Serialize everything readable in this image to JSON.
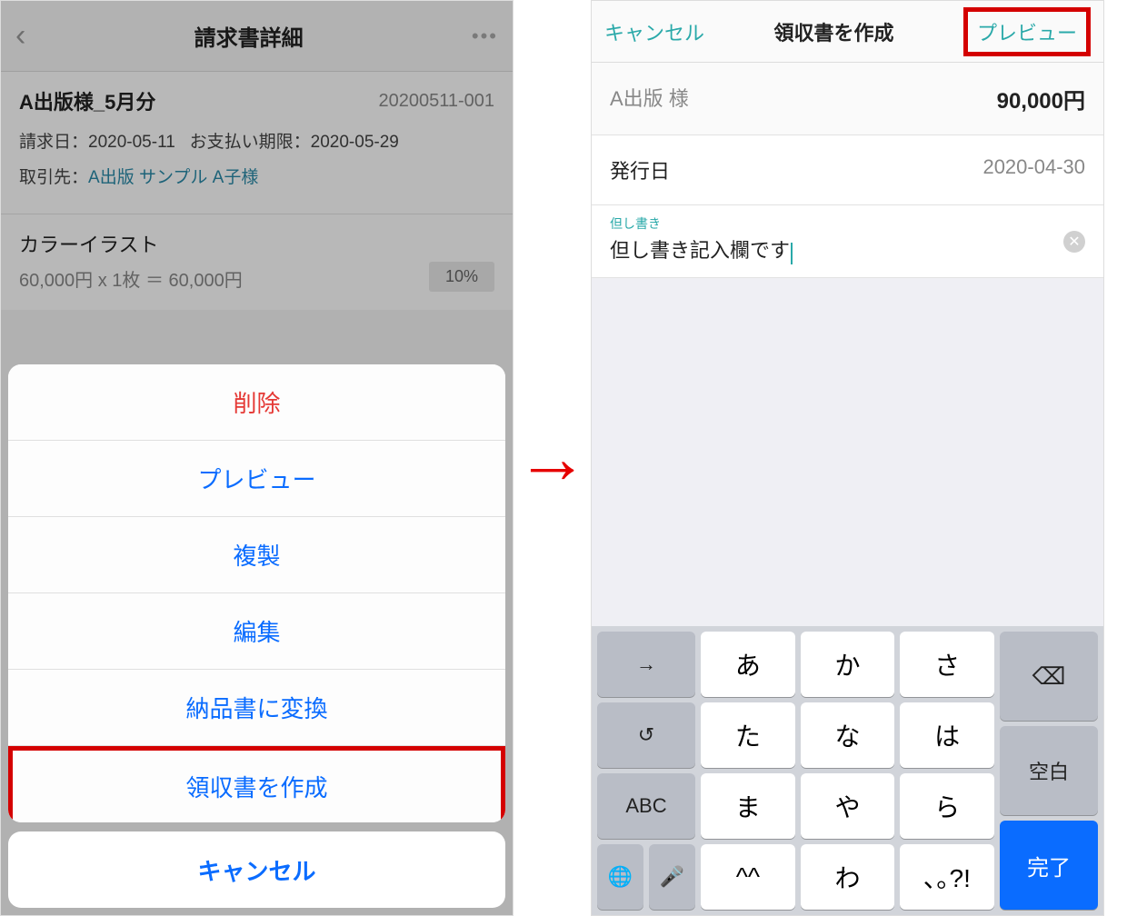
{
  "left": {
    "header": {
      "title": "請求書詳細"
    },
    "doc": {
      "title": "A出版様_5月分",
      "number": "20200511-001",
      "invoice_date_label": "請求日：",
      "invoice_date": "2020-05-11",
      "due_label": "お支払い期限：",
      "due_date": "2020-05-29",
      "client_label": "取引先：",
      "client_link": "A出版 サンプル A子様"
    },
    "item": {
      "name": "カラーイラスト",
      "calc": "60,000円 x 1枚 ＝ 60,000円",
      "tax": "10%"
    },
    "sheet": {
      "delete": "削除",
      "preview": "プレビュー",
      "duplicate": "複製",
      "edit": "編集",
      "convert": "納品書に変換",
      "receipt": "領収書を作成",
      "cancel": "キャンセル"
    }
  },
  "right": {
    "header": {
      "cancel": "キャンセル",
      "title": "領収書を作成",
      "preview": "プレビュー"
    },
    "summary": {
      "name": "A出版 様",
      "amount": "90,000円"
    },
    "issue": {
      "label": "発行日",
      "value": "2020-04-30"
    },
    "memo": {
      "label": "但し書き",
      "value": "但し書き記入欄です"
    },
    "keyboard": {
      "tab": "→",
      "undo": "↺",
      "abc": "ABC",
      "r1": [
        "あ",
        "か",
        "さ"
      ],
      "r2": [
        "た",
        "な",
        "は"
      ],
      "r3": [
        "ま",
        "や",
        "ら"
      ],
      "r4": [
        "^^",
        "わ",
        "､｡?!"
      ],
      "bksp": "⌫",
      "space": "空白",
      "done": "完了",
      "globe": "🌐",
      "mic": "🎤"
    }
  }
}
